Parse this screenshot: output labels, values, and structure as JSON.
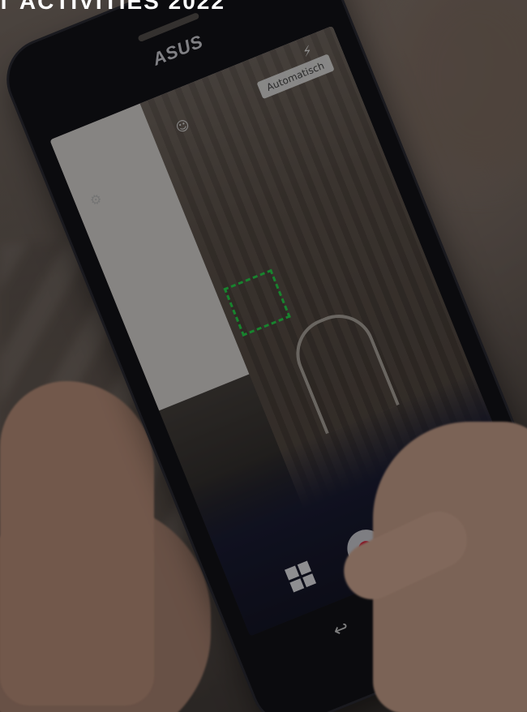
{
  "page": {
    "title": "T ACTIVITIES 2022"
  },
  "phone": {
    "brand": "ASUS",
    "camera_ui": {
      "mode_label": "Automatisch",
      "icons": [
        "flash-icon",
        "person-icon",
        "settings-icon",
        "camera-icon",
        "record-icon",
        "mode-grid-icon",
        "back-icon",
        "home-icon",
        "recent-apps-icon"
      ]
    },
    "nav": {
      "back": "↩",
      "home": "⌂",
      "recent": "▭"
    }
  },
  "colors": {
    "focus": "#27d44b",
    "record": "#d8213a"
  }
}
